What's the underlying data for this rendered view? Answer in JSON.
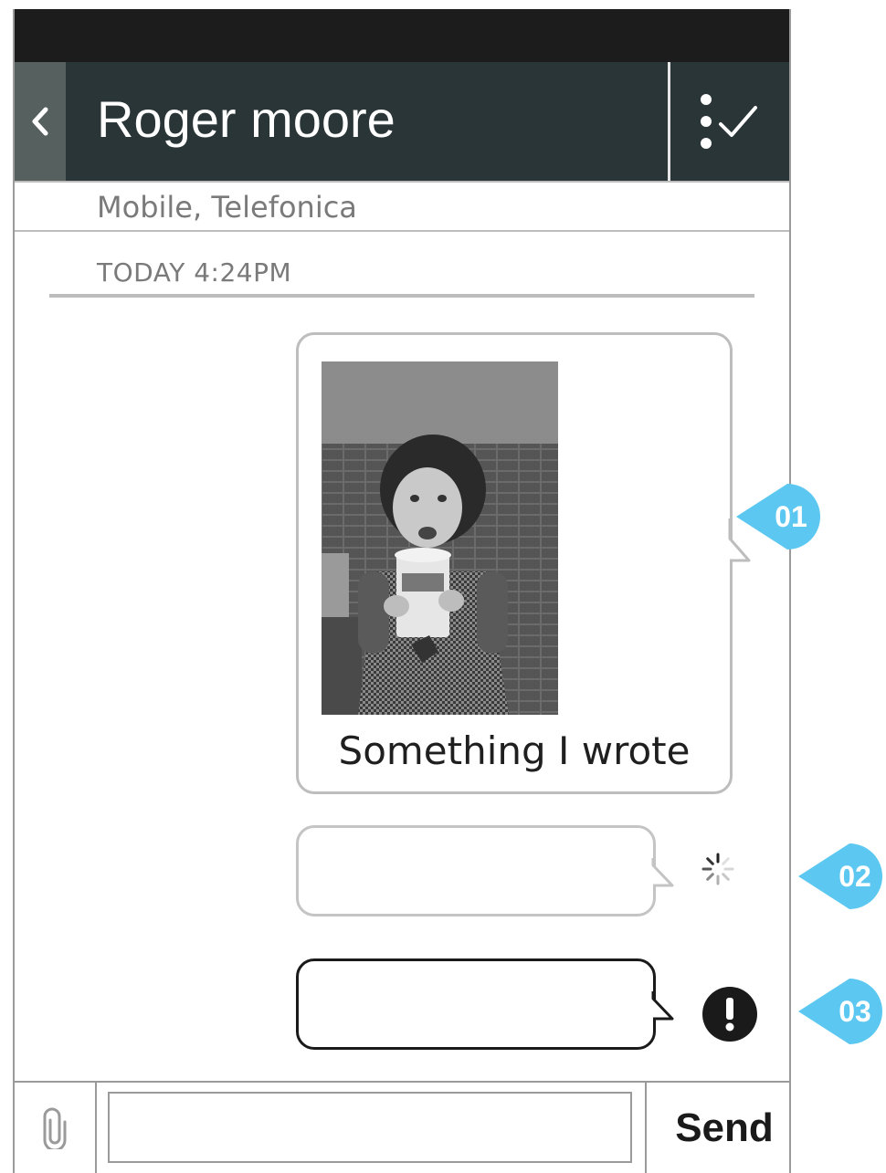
{
  "header": {
    "title": "Roger moore",
    "back_icon": "chevron-left-icon",
    "actions_icon": "more-vert-check-icon"
  },
  "contact": {
    "subtitle": "Mobile, Telefonica"
  },
  "thread": {
    "timestamp": "TODAY 4:24PM",
    "messages": [
      {
        "type": "image",
        "image_desc": "photo of a child holding a cup",
        "caption": "Something I wrote",
        "status": "sent"
      },
      {
        "type": "text",
        "text": "",
        "status": "sending"
      },
      {
        "type": "text",
        "text": "",
        "status": "error"
      }
    ]
  },
  "annotations": {
    "m1": "01",
    "m2": "02",
    "m3": "03"
  },
  "composer": {
    "attach_icon": "paperclip-icon",
    "input_value": "",
    "input_placeholder": "",
    "send_label": "Send"
  },
  "colors": {
    "statusbar": "#1c1c1c",
    "header": "#2a3538",
    "back": "#56605f",
    "marker": "#5cc8f2"
  }
}
